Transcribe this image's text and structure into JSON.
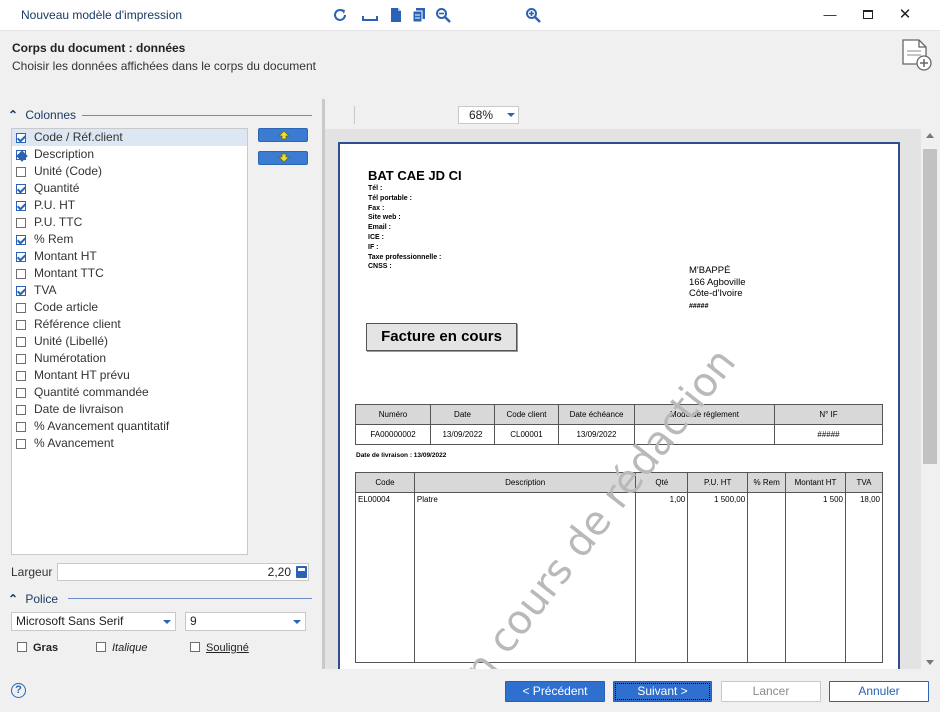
{
  "window": {
    "title": "Nouveau modèle d'impression",
    "controls": {
      "minimize": "—",
      "close": "✕"
    }
  },
  "header": {
    "title": "Corps du document : données",
    "subtitle": "Choisir les données affichées dans le corps du document",
    "icon": "document-add-icon"
  },
  "columns_group": {
    "label": "Colonnes",
    "items": [
      {
        "label": "Code / Réf.client",
        "state": "checked",
        "selected": true
      },
      {
        "label": "Description",
        "state": "partial"
      },
      {
        "label": "Unité (Code)",
        "state": "unchecked"
      },
      {
        "label": "Quantité",
        "state": "checked"
      },
      {
        "label": "P.U. HT",
        "state": "checked"
      },
      {
        "label": "P.U. TTC",
        "state": "unchecked"
      },
      {
        "label": "% Rem",
        "state": "checked"
      },
      {
        "label": "Montant HT",
        "state": "checked"
      },
      {
        "label": "Montant TTC",
        "state": "unchecked"
      },
      {
        "label": "TVA",
        "state": "checked"
      },
      {
        "label": "Code article",
        "state": "unchecked"
      },
      {
        "label": "Référence client",
        "state": "unchecked"
      },
      {
        "label": "Unité (Libellé)",
        "state": "unchecked"
      },
      {
        "label": "Numérotation",
        "state": "unchecked"
      },
      {
        "label": "Montant HT prévu",
        "state": "unchecked"
      },
      {
        "label": "Quantité commandée",
        "state": "unchecked"
      },
      {
        "label": "Date de livraison",
        "state": "unchecked"
      },
      {
        "label": "% Avancement quantitatif",
        "state": "unchecked"
      },
      {
        "label": "% Avancement",
        "state": "unchecked"
      }
    ],
    "move_up": "arrow-up-icon",
    "move_down": "arrow-down-icon",
    "width_label": "Largeur",
    "width_value": "2,20"
  },
  "font_group": {
    "label": "Police",
    "font_name": "Microsoft Sans Serif",
    "font_size": "9",
    "bold": "Gras",
    "italic": "Italique",
    "underline": "Souligné"
  },
  "toolbar": {
    "refresh": "refresh-icon",
    "zoom": "68%"
  },
  "preview": {
    "company": "BAT CAE JD CI",
    "fields": [
      "Tél :",
      "Tél portable :",
      "Fax :",
      "Site web :",
      "Email :",
      "ICE :",
      "IF :",
      "Taxe professionnelle :",
      "CNSS :"
    ],
    "client_name": "M'BAPPÉ",
    "client_address1": "166 Agboville",
    "client_address2": "Côte-d'Ivoire",
    "client_code": "#####",
    "doc_title": "Facture en cours",
    "info_headers": [
      "Numéro",
      "Date",
      "Code client",
      "Date échéance",
      "Mode de règlement",
      "N° IF"
    ],
    "info_values": [
      "FA00000002",
      "13/09/2022",
      "CL00001",
      "13/09/2022",
      "",
      "#####"
    ],
    "delivery": "Date de livraison : 13/09/2022",
    "line_headers": [
      "Code",
      "Description",
      "Qté",
      "P.U. HT",
      "% Rem",
      "Montant HT",
      "TVA"
    ],
    "line_values": [
      "EL00004",
      "Platre",
      "1,00",
      "1 500,00",
      "",
      "1 500",
      "18,00"
    ],
    "watermark": "En cours de rédaction"
  },
  "footer": {
    "help": "?",
    "prev": "< Précédent",
    "next": "Suivant >",
    "cancel": "Lancer",
    "abort": "Annuler"
  },
  "colors": {
    "accent": "#2f6fd0",
    "page_border": "#2f4e8f",
    "group_title": "#1a3a66"
  }
}
